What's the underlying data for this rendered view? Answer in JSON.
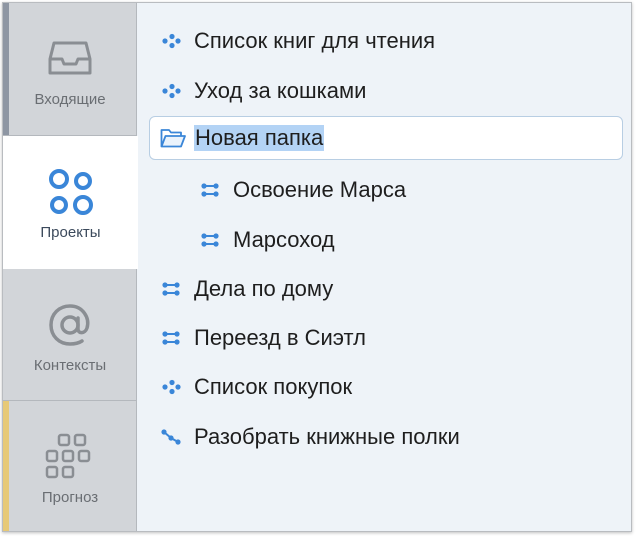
{
  "sidebar": {
    "tabs": [
      {
        "id": "inbox",
        "label": "Входящие",
        "icon": "inbox-tray-icon"
      },
      {
        "id": "projects",
        "label": "Проекты",
        "icon": "projects-circles-icon",
        "selected": true
      },
      {
        "id": "contexts",
        "label": "Контексты",
        "icon": "at-sign-icon"
      },
      {
        "id": "forecast",
        "label": "Прогноз",
        "icon": "grid-calendar-icon"
      }
    ]
  },
  "projects": {
    "items": [
      {
        "label": "Список книг для чтения",
        "icon": "single-actions-icon",
        "indent": 0
      },
      {
        "label": "Уход за кошками",
        "icon": "single-actions-icon",
        "indent": 0
      },
      {
        "label": "Новая папка",
        "icon": "folder-open-icon",
        "indent": 0,
        "selected": true
      },
      {
        "label": "Освоение Марса",
        "icon": "parallel-project-icon",
        "indent": 1
      },
      {
        "label": "Марсоход",
        "icon": "parallel-project-icon",
        "indent": 1
      },
      {
        "label": "Дела по дому",
        "icon": "parallel-project-icon",
        "indent": 0
      },
      {
        "label": "Переезд в Сиэтл",
        "icon": "parallel-project-icon",
        "indent": 0
      },
      {
        "label": "Список покупок",
        "icon": "single-actions-icon",
        "indent": 0
      },
      {
        "label": "Разобрать книжные полки",
        "icon": "sequential-project-icon",
        "indent": 0
      }
    ]
  },
  "colors": {
    "accent": "#3a86d8",
    "selection": "#b3d3f5",
    "sidebar_bg": "#d2d5d9",
    "list_bg": "#eef3f8",
    "inbox_stripe": "#8e96a3",
    "forecast_stripe": "#e7c977"
  }
}
